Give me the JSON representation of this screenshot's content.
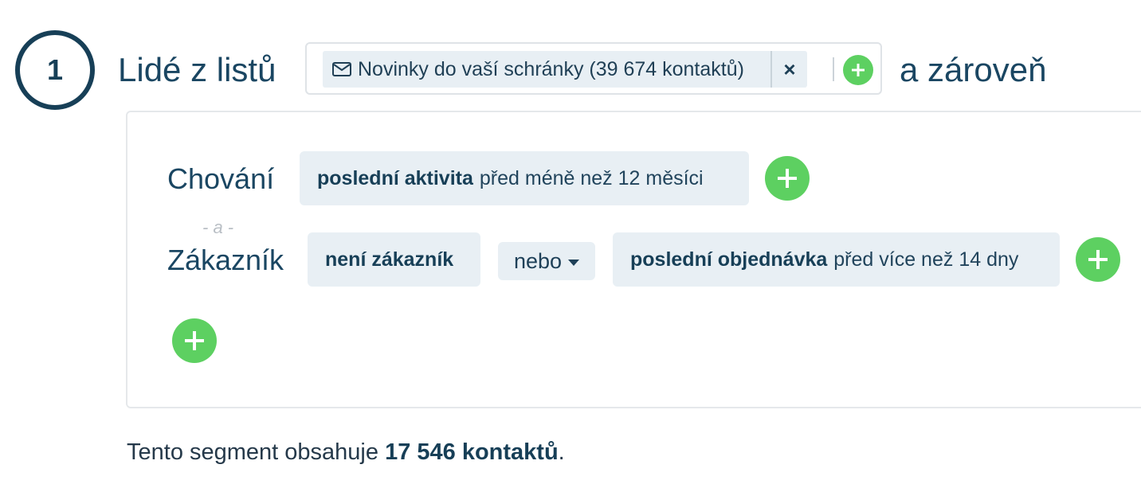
{
  "step": {
    "number": "1",
    "lists_label": "Lidé z listů",
    "and_label": "a zároveň"
  },
  "list_select": {
    "chip_text": "Novinky do vaší schránky (39 674 kontaktů)",
    "remove_symbol": "×",
    "chip_icon": "envelope-icon"
  },
  "conditions": {
    "behavior": {
      "label": "Chování",
      "chip_bold": "poslední aktivita",
      "chip_rest": "před méně než 12 měsíci"
    },
    "separator": "- a -",
    "customer": {
      "label": "Zákazník",
      "chip_not_customer": "není zákazník",
      "or_select": "nebo",
      "chip_last_order_bold": "poslední objednávka",
      "chip_last_order_rest": "před více než 14 dny"
    }
  },
  "summary": {
    "prefix": "Tento segment obsahuje ",
    "count": "17 546 kontaktů",
    "suffix": "."
  },
  "colors": {
    "primary": "#173f57",
    "add_green": "#5dd061",
    "chip_bg": "#e8eff4"
  }
}
